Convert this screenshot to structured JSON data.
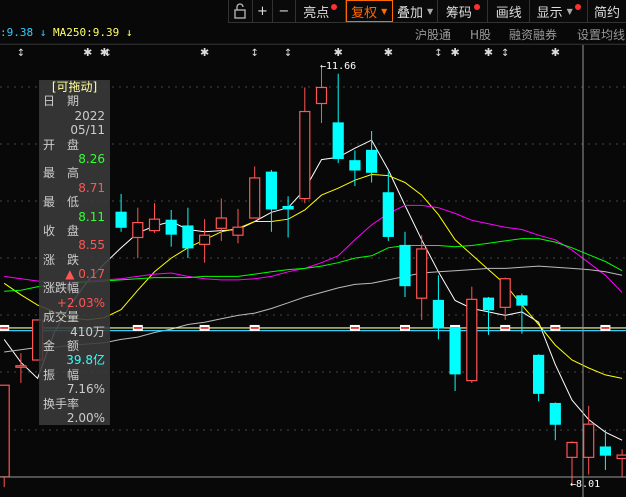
{
  "toolbar": {
    "items": [
      {
        "label": "",
        "icon": "lock-open-icon"
      },
      {
        "label": "+"
      },
      {
        "label": "−"
      },
      {
        "label": "亮点",
        "dot": true
      },
      {
        "label": "复权",
        "caret": true,
        "active": true
      },
      {
        "label": "叠加",
        "caret": true
      },
      {
        "label": "筹码",
        "dot": true
      },
      {
        "label": "画线"
      },
      {
        "label": "显示",
        "caret": true,
        "dot": true
      },
      {
        "label": "简约"
      }
    ]
  },
  "ma_header": {
    "ma_prev": ":9.38",
    "ma_prev_arrow": "↓",
    "ma250": "MA250:9.39",
    "ma250_arrow": "↓"
  },
  "links": [
    "沪股通",
    "H股",
    "融资融券",
    "设置均线"
  ],
  "info_panel": {
    "title": "[可拖动]",
    "date_label": "日　期",
    "year": "2022",
    "date": "05/11",
    "open_label": "开　盘",
    "open": "8.26",
    "high_label": "最　高",
    "high": "8.71",
    "low_label": "最　低",
    "low": "8.11",
    "close_label": "收　盘",
    "close": "8.55",
    "change_label": "涨　跌",
    "change": "▲ 0.17",
    "pct_label": "涨跌幅",
    "pct": "+2.03%",
    "vol_label": "成交量",
    "vol": "410万",
    "amount_label": "金　额",
    "amount": "39.8亿",
    "amp_label": "振　幅",
    "amp": "7.16%",
    "turnover_label": "换手率",
    "turnover": "2.00%"
  },
  "annotations": {
    "high": "11.66",
    "low": "8.01"
  },
  "colors": {
    "up": "#ff5555",
    "down": "#00ffff",
    "ma5": "#ffffff",
    "ma10": "#ffff00",
    "ma20": "#ff00ff",
    "ma30": "#00ff00",
    "ma60": "#bbbbbb",
    "ma250": "#ffff99"
  },
  "chart_data": {
    "type": "candlestick",
    "price_range": [
      8.01,
      11.66
    ],
    "candles": [
      [
        8.09,
        8.89,
        8.0,
        8.89
      ],
      [
        9.05,
        9.17,
        8.91,
        9.06
      ],
      [
        9.11,
        9.46,
        9.11,
        9.46
      ],
      null,
      null,
      null,
      null,
      [
        10.4,
        10.56,
        10.23,
        10.27
      ],
      [
        10.18,
        10.44,
        10.0,
        10.31
      ],
      [
        10.24,
        10.48,
        10.22,
        10.34
      ],
      [
        10.33,
        10.42,
        10.1,
        10.21
      ],
      [
        10.28,
        10.44,
        10.0,
        10.09
      ],
      [
        10.12,
        10.34,
        9.96,
        10.2
      ],
      [
        10.26,
        10.52,
        10.15,
        10.35
      ],
      [
        10.2,
        10.43,
        10.13,
        10.27
      ],
      [
        10.35,
        10.8,
        10.35,
        10.7
      ],
      [
        10.75,
        10.77,
        10.23,
        10.43
      ],
      [
        10.45,
        10.54,
        10.18,
        10.43
      ],
      [
        10.52,
        11.49,
        10.48,
        11.28
      ],
      [
        11.35,
        11.66,
        11.18,
        11.49
      ],
      [
        11.18,
        11.61,
        10.83,
        10.87
      ],
      [
        10.85,
        10.94,
        10.63,
        10.77
      ],
      [
        10.94,
        11.11,
        10.66,
        10.75
      ],
      [
        10.57,
        10.75,
        10.15,
        10.19
      ],
      [
        10.11,
        10.23,
        9.66,
        9.76
      ],
      [
        9.65,
        10.2,
        9.46,
        10.08
      ],
      [
        9.63,
        9.85,
        9.29,
        9.39
      ],
      [
        9.39,
        9.39,
        8.84,
        8.99
      ],
      [
        8.93,
        9.75,
        8.91,
        9.64
      ],
      [
        9.65,
        9.66,
        9.33,
        9.55
      ],
      [
        9.57,
        9.83,
        9.46,
        9.82
      ],
      [
        9.67,
        9.69,
        9.34,
        9.59
      ],
      [
        9.15,
        9.16,
        8.75,
        8.82
      ],
      [
        8.73,
        8.74,
        8.41,
        8.55
      ],
      [
        8.26,
        8.4,
        8.01,
        8.39
      ],
      [
        8.26,
        8.71,
        8.11,
        8.55
      ],
      [
        8.35,
        8.5,
        8.15,
        8.28
      ],
      [
        8.25,
        8.33,
        8.09,
        8.28
      ]
    ],
    "ma": [
      {
        "name": "MA5",
        "color": "#ffffff",
        "values": [
          9.29,
          9.09,
          8.95,
          9.35,
          9.6,
          9.8,
          9.95,
          10.09,
          10.22,
          10.28,
          10.32,
          10.25,
          10.23,
          10.24,
          10.25,
          10.32,
          10.4,
          10.44,
          10.6,
          10.86,
          10.88,
          10.96,
          11.03,
          10.77,
          10.46,
          10.16,
          9.88,
          9.63,
          9.56,
          9.53,
          9.5,
          9.53,
          9.44,
          9.07,
          8.76,
          8.59,
          8.48,
          8.41
        ]
      },
      {
        "name": "MA10",
        "color": "#ffff00",
        "values": [
          9.78,
          9.68,
          9.59,
          9.53,
          9.48,
          9.46,
          9.48,
          9.55,
          9.72,
          9.88,
          10.0,
          10.09,
          10.16,
          10.23,
          10.26,
          10.32,
          10.32,
          10.34,
          10.42,
          10.55,
          10.61,
          10.68,
          10.73,
          10.72,
          10.66,
          10.55,
          10.38,
          10.16,
          10.03,
          9.9,
          9.77,
          9.59,
          9.42,
          9.24,
          9.11,
          9.04,
          8.98,
          8.95
        ]
      },
      {
        "name": "MA20",
        "color": "#ff00ff",
        "values": [
          9.84,
          9.82,
          9.8,
          9.79,
          9.79,
          9.8,
          9.81,
          9.82,
          9.84,
          9.86,
          9.87,
          9.84,
          9.82,
          9.81,
          9.81,
          9.82,
          9.84,
          9.88,
          9.91,
          9.96,
          10.02,
          10.16,
          10.29,
          10.39,
          10.46,
          10.46,
          10.44,
          10.39,
          10.33,
          10.3,
          10.27,
          10.25,
          10.2,
          10.16,
          10.07,
          9.96,
          9.85,
          9.7
        ]
      },
      {
        "name": "MA30",
        "color": "#00ff00",
        "values": [
          9.71,
          9.72,
          9.75,
          9.77,
          9.78,
          9.79,
          9.8,
          9.81,
          9.82,
          9.83,
          9.83,
          9.83,
          9.84,
          9.84,
          9.84,
          9.86,
          9.88,
          9.9,
          9.91,
          9.93,
          9.96,
          10.0,
          10.02,
          10.09,
          10.11,
          10.11,
          10.11,
          10.1,
          10.11,
          10.13,
          10.15,
          10.17,
          10.17,
          10.14,
          10.09,
          10.03,
          9.97,
          9.89
        ]
      },
      {
        "name": "MA60",
        "color": "#bbbbbb",
        "values": [
          9.18,
          9.2,
          9.22,
          9.22,
          9.24,
          9.25,
          9.26,
          9.29,
          9.31,
          9.35,
          9.38,
          9.42,
          9.44,
          9.47,
          9.5,
          9.52,
          9.56,
          9.61,
          9.66,
          9.7,
          9.74,
          9.77,
          9.78,
          9.81,
          9.84,
          9.87,
          9.88,
          9.89,
          9.9,
          9.91,
          9.91,
          9.92,
          9.93,
          9.92,
          9.91,
          9.9,
          9.88,
          9.85
        ]
      },
      {
        "name": "MA250",
        "color": "#ffff99",
        "value": 9.39
      },
      {
        "name": "MA120",
        "color": "#33ccff",
        "value": 9.38
      }
    ],
    "flat_markers_idx": [
      0,
      8,
      12,
      15,
      21,
      24,
      27,
      30,
      33,
      36
    ],
    "event_markers": [
      {
        "idx": 1,
        "kind": "arrow"
      },
      {
        "idx": 5,
        "kind": "star"
      },
      {
        "idx": 6,
        "kind": "star"
      },
      {
        "idx": 6.2,
        "kind": "arrow"
      },
      {
        "idx": 12,
        "kind": "star"
      },
      {
        "idx": 15,
        "kind": "arrow"
      },
      {
        "idx": 17,
        "kind": "arrow"
      },
      {
        "idx": 20,
        "kind": "star"
      },
      {
        "idx": 23,
        "kind": "star"
      },
      {
        "idx": 26,
        "kind": "arrow"
      },
      {
        "idx": 27,
        "kind": "star"
      },
      {
        "idx": 29,
        "kind": "star"
      },
      {
        "idx": 30,
        "kind": "arrow"
      },
      {
        "idx": 33,
        "kind": "star"
      }
    ]
  }
}
